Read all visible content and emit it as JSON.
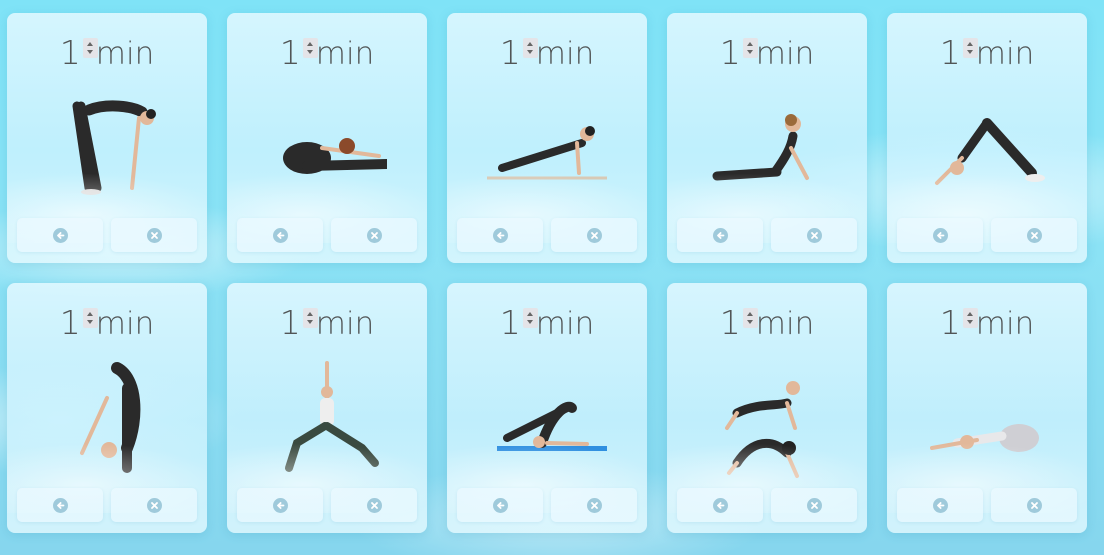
{
  "colors": {
    "accent_icon": "#9fcadb",
    "yoga_mat": "#2f8fe0",
    "outfit": "#2a2a2a",
    "skin": "#e2b89a"
  },
  "cards": [
    {
      "value": "1",
      "unit": "min",
      "pose": "standing-forward-bend-figure",
      "back_icon": "arrow-left-circle-icon",
      "delete_icon": "x-circle-icon"
    },
    {
      "value": "1",
      "unit": "min",
      "pose": "seated-forward-bend-figure",
      "back_icon": "arrow-left-circle-icon",
      "delete_icon": "x-circle-icon"
    },
    {
      "value": "1",
      "unit": "min",
      "pose": "plank-figure",
      "back_icon": "arrow-left-circle-icon",
      "delete_icon": "x-circle-icon"
    },
    {
      "value": "1",
      "unit": "min",
      "pose": "cobra-figure",
      "back_icon": "arrow-left-circle-icon",
      "delete_icon": "x-circle-icon"
    },
    {
      "value": "1",
      "unit": "min",
      "pose": "downward-dog-figure",
      "back_icon": "arrow-left-circle-icon",
      "delete_icon": "x-circle-icon"
    },
    {
      "value": "1",
      "unit": "min",
      "pose": "deep-forward-fold-figure",
      "back_icon": "arrow-left-circle-icon",
      "delete_icon": "x-circle-icon"
    },
    {
      "value": "1",
      "unit": "min",
      "pose": "warrior-lunge-figure",
      "back_icon": "arrow-left-circle-icon",
      "delete_icon": "x-circle-icon"
    },
    {
      "value": "1",
      "unit": "min",
      "pose": "plow-pose-figure",
      "back_icon": "arrow-left-circle-icon",
      "delete_icon": "x-circle-icon"
    },
    {
      "value": "1",
      "unit": "min",
      "pose": "cat-cow-figure",
      "back_icon": "arrow-left-circle-icon",
      "delete_icon": "x-circle-icon"
    },
    {
      "value": "1",
      "unit": "min",
      "pose": "childs-pose-figure",
      "back_icon": "arrow-left-circle-icon",
      "delete_icon": "x-circle-icon"
    }
  ]
}
